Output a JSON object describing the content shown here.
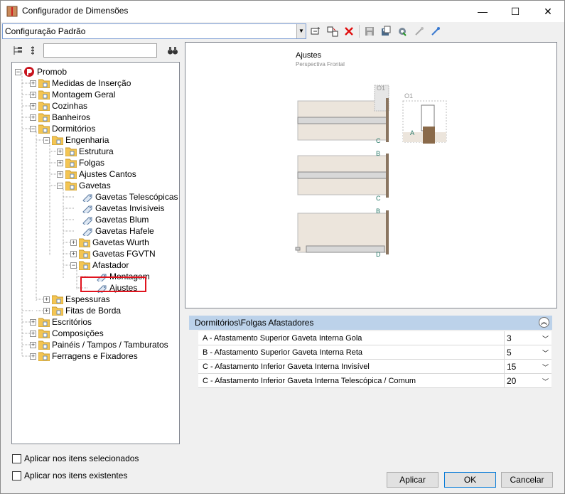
{
  "window": {
    "title": "Configurador de Dimensões",
    "minimize": "—",
    "maximize": "☐",
    "close": "✕"
  },
  "config": {
    "selected": "Configuração Padrão"
  },
  "toolbar": {
    "icons": [
      "new-config-icon",
      "copy-config-icon",
      "delete-icon",
      "save-icon",
      "save-as-icon",
      "settings-icon",
      "import-icon",
      "export-icon"
    ]
  },
  "search": {
    "value": "",
    "placeholder": ""
  },
  "tree": [
    {
      "label": "Promob"
    },
    {
      "label": "Medidas de Inserção"
    },
    {
      "label": "Montagem Geral"
    },
    {
      "label": "Cozinhas"
    },
    {
      "label": "Banheiros"
    },
    {
      "label": "Dormitórios"
    },
    {
      "label": "Engenharia"
    },
    {
      "label": "Estrutura"
    },
    {
      "label": "Folgas"
    },
    {
      "label": "Ajustes Cantos"
    },
    {
      "label": "Gavetas"
    },
    {
      "label": "Gavetas Telescópicas"
    },
    {
      "label": "Gavetas Invisíveis"
    },
    {
      "label": "Gavetas Blum"
    },
    {
      "label": "Gavetas Hafele"
    },
    {
      "label": "Gavetas Wurth"
    },
    {
      "label": "Gavetas FGVTN"
    },
    {
      "label": "Afastador"
    },
    {
      "label": "Montagem"
    },
    {
      "label": "Ajustes"
    },
    {
      "label": "Espessuras"
    },
    {
      "label": "Fitas de Borda"
    },
    {
      "label": "Escritórios"
    },
    {
      "label": "Composições"
    },
    {
      "label": "Painéis / Tampos / Tamburatos"
    },
    {
      "label": "Ferragens e Fixadores"
    }
  ],
  "preview": {
    "title": "Ajustes",
    "subtitle": "Perspectiva Frontal",
    "labels": {
      "o1a": "O1",
      "o1b": "O1",
      "a": "A",
      "b1": "B",
      "b2": "B",
      "c1": "C",
      "c2": "C",
      "d": "D"
    }
  },
  "properties": {
    "header": "Dormitórios\\Folgas Afastadores",
    "rows": [
      {
        "label": "A - Afastamento Superior Gaveta Interna Gola",
        "value": "3"
      },
      {
        "label": "B - Afastamento Superior Gaveta Interna Reta",
        "value": "5"
      },
      {
        "label": "C - Afastamento Inferior Gaveta Interna Invisível",
        "value": "15"
      },
      {
        "label": "C - Afastamento Inferior Gaveta Interna Telescópica / Comum",
        "value": "20"
      }
    ]
  },
  "options": {
    "apply_selected": "Aplicar nos itens selecionados",
    "apply_existing": "Aplicar nos itens existentes"
  },
  "buttons": {
    "apply": "Aplicar",
    "ok": "OK",
    "cancel": "Cancelar"
  },
  "colors": {
    "selection": "#e0141e",
    "header": "#bcd2ea",
    "accent": "#0078d7"
  }
}
